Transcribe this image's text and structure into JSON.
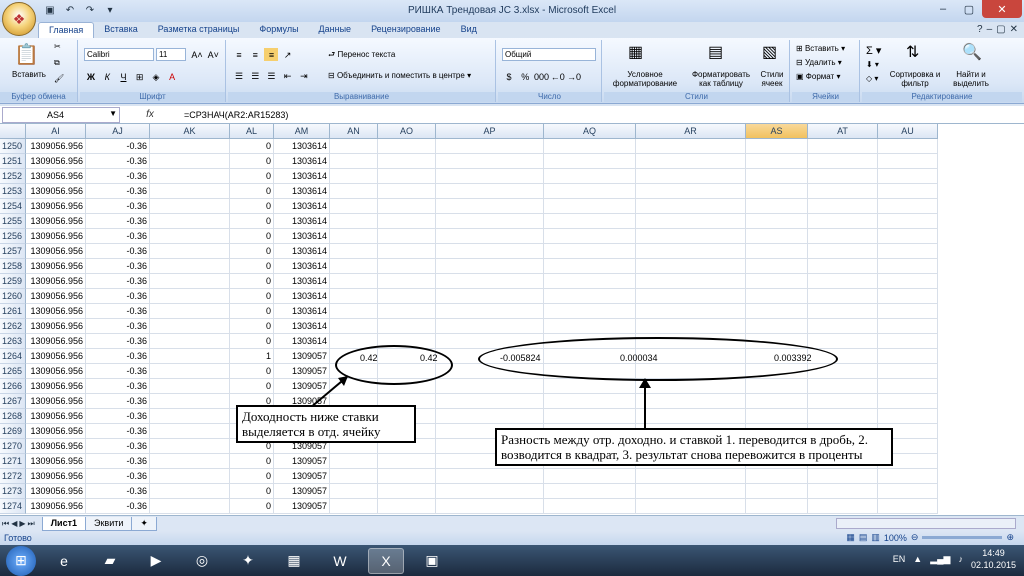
{
  "window": {
    "title": "РИШКА Трендовая JC 3.xlsx - Microsoft Excel"
  },
  "tabs": [
    "Главная",
    "Вставка",
    "Разметка страницы",
    "Формулы",
    "Данные",
    "Рецензирование",
    "Вид"
  ],
  "ribbon": {
    "clipboard": {
      "paste": "Вставить",
      "label": "Буфер обмена"
    },
    "font": {
      "name": "Calibri",
      "size": "11",
      "label": "Шрифт",
      "bold": "Ж",
      "italic": "К",
      "underline": "Ч"
    },
    "alignment": {
      "wrap": "Перенос текста",
      "merge": "Объединить и поместить в центре",
      "label": "Выравнивание"
    },
    "number": {
      "format": "Общий",
      "label": "Число"
    },
    "styles": {
      "conditional": "Условное форматирование",
      "table": "Форматировать как таблицу",
      "cell": "Стили ячеек",
      "label": "Стили"
    },
    "cells": {
      "insert": "Вставить",
      "delete": "Удалить",
      "format": "Формат",
      "label": "Ячейки"
    },
    "editing": {
      "sort": "Сортировка и фильтр",
      "find": "Найти и выделить",
      "label": "Редактирование"
    }
  },
  "formula_bar": {
    "name_box": "AS4",
    "fx": "fx",
    "formula": "=СРЗНАЧ(AR2:AR15283)"
  },
  "columns": [
    "AI",
    "AJ",
    "AK",
    "AL",
    "AM",
    "AN",
    "AO",
    "AP",
    "AQ",
    "AR",
    "AS",
    "AT",
    "AU"
  ],
  "selected_column": "AS",
  "rows": [
    {
      "n": "1250",
      "ai": "1309056.956",
      "aj": "-0.36",
      "al": "0",
      "am": "1303614"
    },
    {
      "n": "1251",
      "ai": "1309056.956",
      "aj": "-0.36",
      "al": "0",
      "am": "1303614"
    },
    {
      "n": "1252",
      "ai": "1309056.956",
      "aj": "-0.36",
      "al": "0",
      "am": "1303614"
    },
    {
      "n": "1253",
      "ai": "1309056.956",
      "aj": "-0.36",
      "al": "0",
      "am": "1303614"
    },
    {
      "n": "1254",
      "ai": "1309056.956",
      "aj": "-0.36",
      "al": "0",
      "am": "1303614"
    },
    {
      "n": "1255",
      "ai": "1309056.956",
      "aj": "-0.36",
      "al": "0",
      "am": "1303614"
    },
    {
      "n": "1256",
      "ai": "1309056.956",
      "aj": "-0.36",
      "al": "0",
      "am": "1303614"
    },
    {
      "n": "1257",
      "ai": "1309056.956",
      "aj": "-0.36",
      "al": "0",
      "am": "1303614"
    },
    {
      "n": "1258",
      "ai": "1309056.956",
      "aj": "-0.36",
      "al": "0",
      "am": "1303614"
    },
    {
      "n": "1259",
      "ai": "1309056.956",
      "aj": "-0.36",
      "al": "0",
      "am": "1303614"
    },
    {
      "n": "1260",
      "ai": "1309056.956",
      "aj": "-0.36",
      "al": "0",
      "am": "1303614"
    },
    {
      "n": "1261",
      "ai": "1309056.956",
      "aj": "-0.36",
      "al": "0",
      "am": "1303614"
    },
    {
      "n": "1262",
      "ai": "1309056.956",
      "aj": "-0.36",
      "al": "0",
      "am": "1303614"
    },
    {
      "n": "1263",
      "ai": "1309056.956",
      "aj": "-0.36",
      "al": "0",
      "am": "1303614"
    },
    {
      "n": "1264",
      "ai": "1309056.956",
      "aj": "-0.36",
      "al": "1",
      "am": "1309057"
    },
    {
      "n": "1265",
      "ai": "1309056.956",
      "aj": "-0.36",
      "al": "0",
      "am": "1309057"
    },
    {
      "n": "1266",
      "ai": "1309056.956",
      "aj": "-0.36",
      "al": "0",
      "am": "1309057"
    },
    {
      "n": "1267",
      "ai": "1309056.956",
      "aj": "-0.36",
      "al": "0",
      "am": "1309057"
    },
    {
      "n": "1268",
      "ai": "1309056.956",
      "aj": "-0.36",
      "al": "0",
      "am": "1309057"
    },
    {
      "n": "1269",
      "ai": "1309056.956",
      "aj": "-0.36",
      "al": "0",
      "am": "1309057"
    },
    {
      "n": "1270",
      "ai": "1309056.956",
      "aj": "-0.36",
      "al": "0",
      "am": "1309057"
    },
    {
      "n": "1271",
      "ai": "1309056.956",
      "aj": "-0.36",
      "al": "0",
      "am": "1309057"
    },
    {
      "n": "1272",
      "ai": "1309056.956",
      "aj": "-0.36",
      "al": "0",
      "am": "1309057"
    },
    {
      "n": "1273",
      "ai": "1309056.956",
      "aj": "-0.36",
      "al": "0",
      "am": "1309057"
    },
    {
      "n": "1274",
      "ai": "1309056.956",
      "aj": "-0.36",
      "al": "0",
      "am": "1309057"
    }
  ],
  "highlight_row": {
    "an": "0.42",
    "ao": "0.42",
    "ap": "-0.005824",
    "aq": "0.000034",
    "ar": "0.003392"
  },
  "annotations": {
    "note1": "Доходность ниже ставки выделяется в отд. ячейку",
    "note2": "Разность между отр. доходно. и ставкой 1. переводится в дробь, 2. возводится в квадрат, 3. результат снова перевожится в проценты"
  },
  "sheets": [
    "Лист1",
    "Эквити"
  ],
  "active_sheet": "Лист1",
  "status": {
    "ready": "Готово",
    "zoom": "100%"
  },
  "taskbar": {
    "lang": "EN",
    "time": "14:49",
    "date": "02.10.2015"
  }
}
